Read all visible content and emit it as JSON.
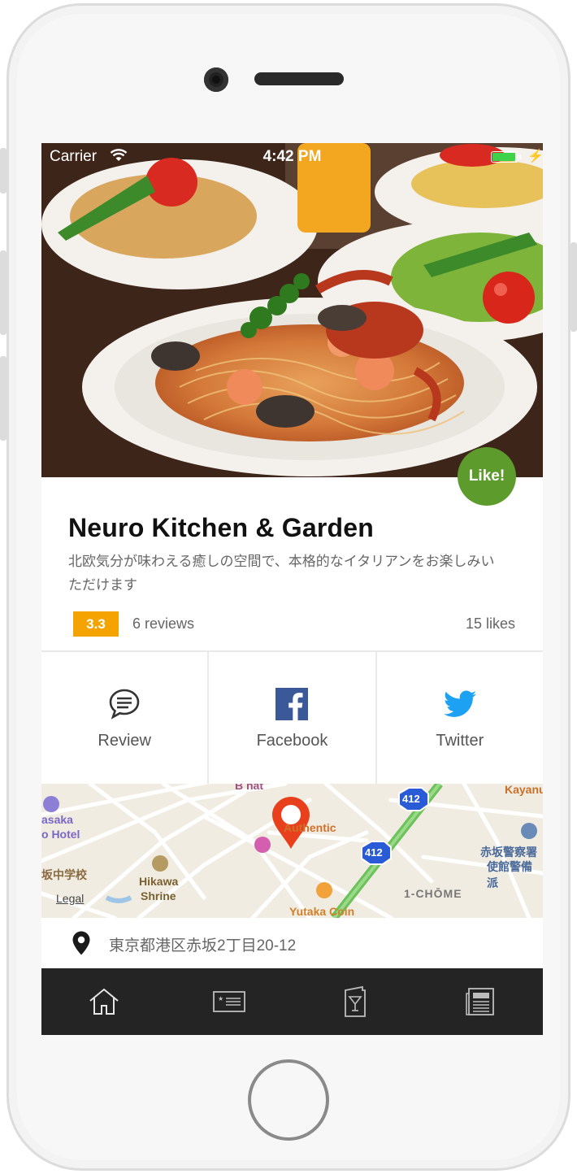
{
  "status_bar": {
    "carrier": "Carrier",
    "time": "4:42 PM",
    "battery_color": "#3ed14a"
  },
  "restaurant": {
    "name": "Neuro Kitchen & Garden",
    "description": "北欧気分が味わえる癒しの空間で、本格的なイタリアンをお楽しみいただけます",
    "rating": "3.3",
    "reviews": "6 reviews",
    "likes": "15 likes",
    "like_button": "Like!"
  },
  "actions": [
    {
      "label": "Review",
      "icon": "chat-bubble-icon"
    },
    {
      "label": "Facebook",
      "icon": "facebook-icon"
    },
    {
      "label": "Twitter",
      "icon": "twitter-icon"
    }
  ],
  "map": {
    "labels": {
      "hotel_a": "asaka",
      "hotel_b": "o Hotel",
      "school": "坂中学校",
      "shrine_a": "Hikawa",
      "shrine_b": "Shrine",
      "legal": "Legal",
      "place": "Authentic",
      "yutaka": "Yutaka Coin",
      "chome": "1-CHŌME",
      "police_a": "赤坂警察署",
      "police_b": "使館警備派",
      "kayanu": "Kayanu",
      "b_hat": "B hat",
      "route_a": "412",
      "route_b": "412"
    }
  },
  "address": "東京都港区赤坂2丁目20-12",
  "tabs": [
    {
      "name": "home",
      "icon": "home-icon"
    },
    {
      "name": "card",
      "icon": "card-icon"
    },
    {
      "name": "drink-menu",
      "icon": "cocktail-menu-icon"
    },
    {
      "name": "news",
      "icon": "newspaper-icon"
    }
  ],
  "colors": {
    "like_green": "#5d9c2c",
    "rating_orange": "#f5a300",
    "tabbar_bg": "#242424",
    "facebook_blue": "#3b5998",
    "twitter_blue": "#1da1f2",
    "pin_red": "#e8401c"
  }
}
